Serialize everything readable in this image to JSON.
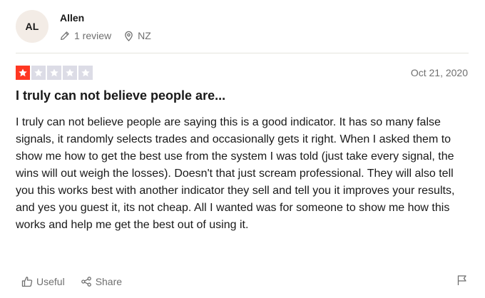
{
  "reviewer": {
    "initials": "AL",
    "name": "Allen",
    "review_count": "1 review",
    "country": "NZ"
  },
  "review": {
    "rating": 1,
    "max_rating": 5,
    "date": "Oct 21, 2020",
    "title": "I truly can not believe people are...",
    "body": "I truly can not believe people are saying this is a good indicator. It has so many false signals, it randomly selects trades and occasionally gets it right. When I asked them to show me how to get the best use from the system I was told (just take every signal, the wins will out weigh the losses). Doesn't that just scream professional. They will also tell you this works best with another indicator they sell and tell you it improves your results, and yes you guest it, its not cheap. All I wanted was for someone to show me how this works and help me get the best out of using it."
  },
  "actions": {
    "useful_label": "Useful",
    "share_label": "Share"
  },
  "icons": {
    "review_count": "pencil-icon",
    "country": "location-pin-icon",
    "useful": "thumbs-up-icon",
    "share": "share-icon",
    "report": "flag-icon",
    "star": "star-icon"
  },
  "colors": {
    "star_filled": "#ff3722",
    "star_empty": "#dcdce6",
    "avatar_bg": "#f3ece6",
    "muted_text": "#6f6f6f",
    "divider": "#e5e5dd"
  }
}
